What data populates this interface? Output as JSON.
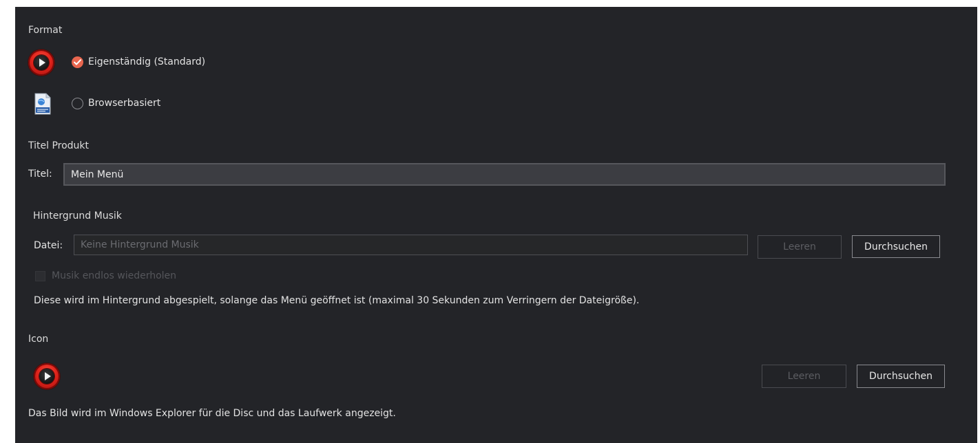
{
  "format": {
    "section_title": "Format",
    "options": [
      {
        "label": "Eigenständig (Standard)",
        "selected": true,
        "icon": "play-disc-icon"
      },
      {
        "label": "Browserbasiert",
        "selected": false,
        "icon": "html-file-icon"
      }
    ]
  },
  "title_section": {
    "section_title": "Titel Produkt",
    "field_label": "Titel:",
    "value": "Mein Menü"
  },
  "music": {
    "section_title": "Hintergrund Musik",
    "field_label": "Datei:",
    "placeholder": "Keine Hintergrund Musik",
    "clear_label": "Leeren",
    "browse_label": "Durchsuchen",
    "loop_label": "Musik endlos wiederholen",
    "loop_checked": false,
    "description": "Diese wird im Hintergrund abgespielt, solange das Menü geöffnet ist (maximal 30 Sekunden zum Verringern der Dateigröße)."
  },
  "icon_section": {
    "section_title": "Icon",
    "icon": "play-disc-icon",
    "clear_label": "Leeren",
    "browse_label": "Durchsuchen",
    "description": "Das Bild wird im Windows Explorer für die Disc und das Laufwerk angezeigt."
  },
  "colors": {
    "background": "#232428",
    "accent": "#e8664f",
    "text": "#e3e3e3",
    "disabled_text": "#55565b"
  }
}
